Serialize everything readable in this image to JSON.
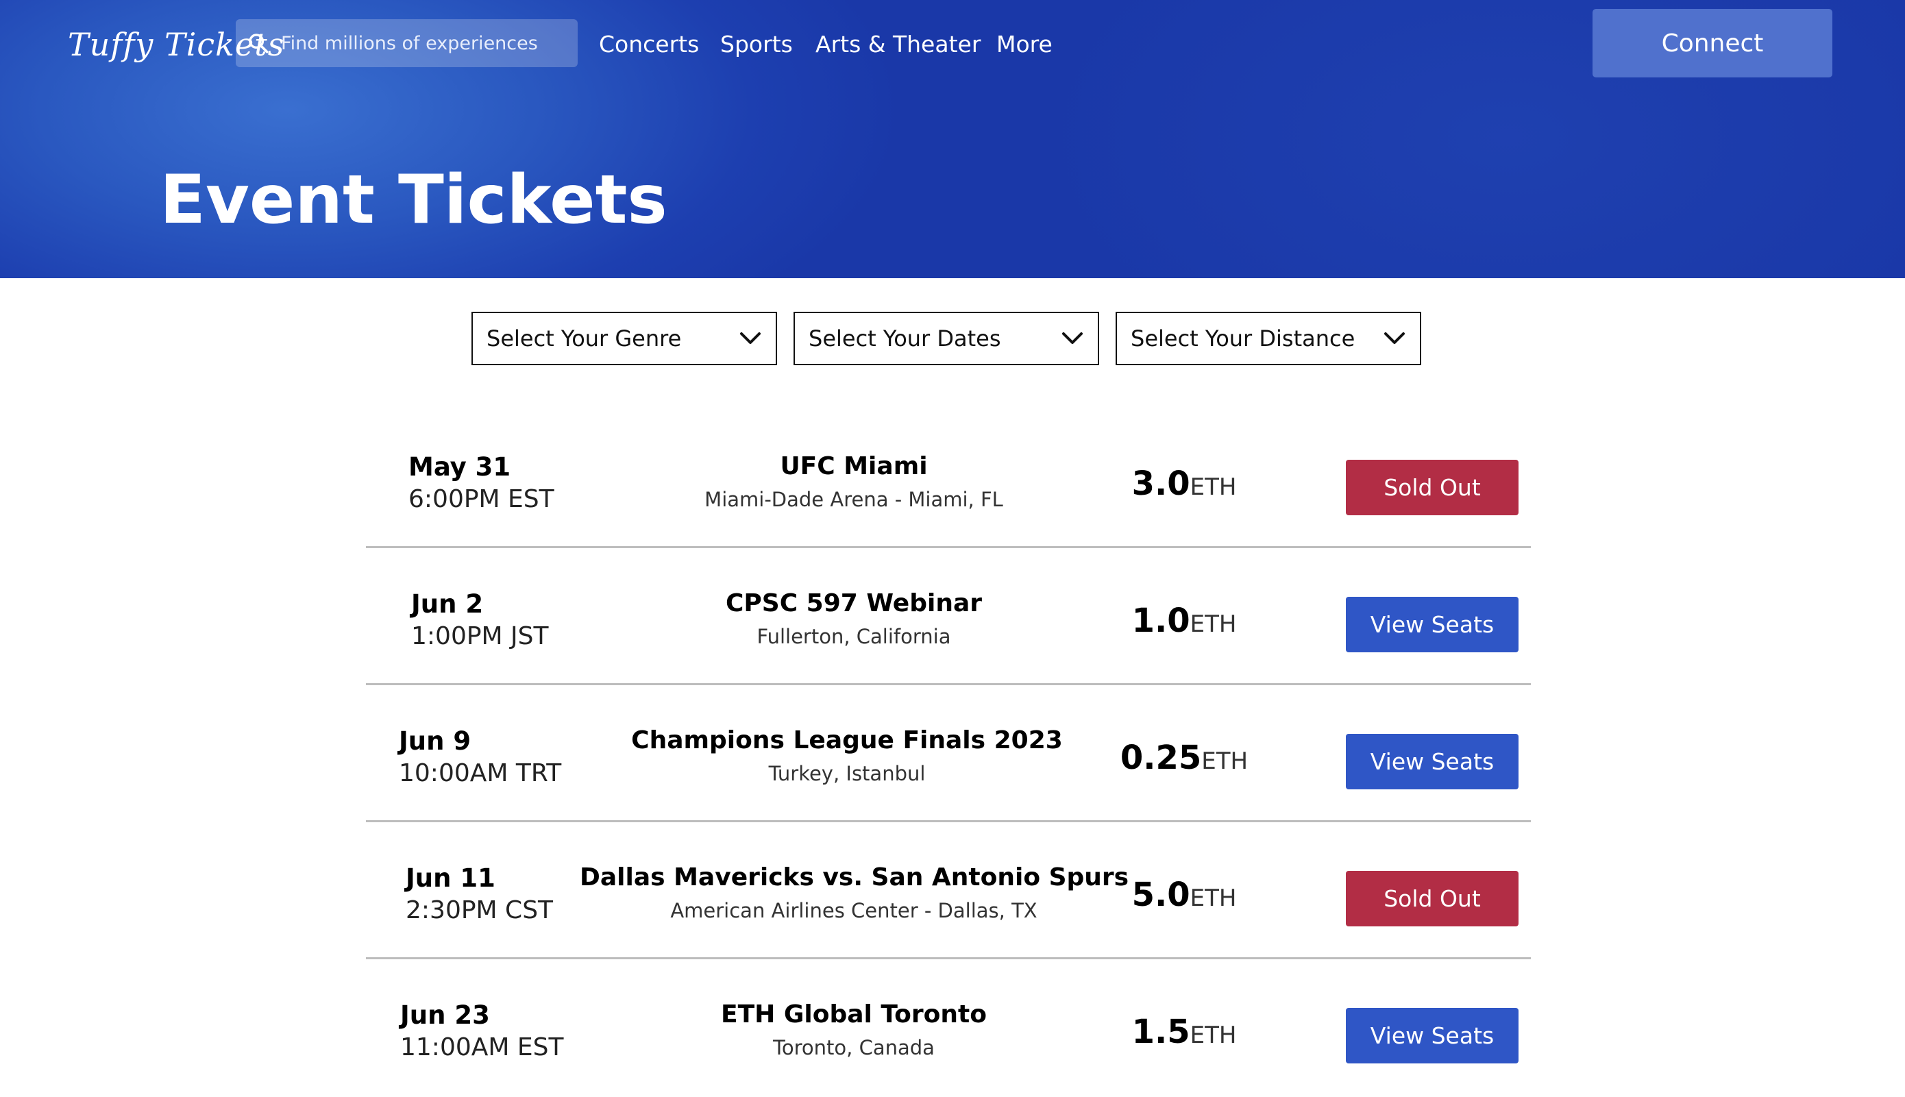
{
  "header": {
    "logo": "Tuffy Tickets",
    "search_placeholder": "Find millions of experiences",
    "nav": [
      "Concerts",
      "Sports",
      "Arts & Theater",
      "More"
    ],
    "connect_label": "Connect",
    "title": "Event Tickets"
  },
  "filters": [
    {
      "label": "Select Your Genre"
    },
    {
      "label": "Select Your Dates"
    },
    {
      "label": "Select Your Distance"
    }
  ],
  "events": [
    {
      "date": "May 31",
      "time": "6:00PM EST",
      "name": "UFC Miami",
      "venue": "Miami-Dade Arena - Miami, FL",
      "price": "3.0",
      "unit": "ETH",
      "action": "Sold Out",
      "status": "sold"
    },
    {
      "date": "Jun 2",
      "time": "1:00PM JST",
      "name": "CPSC 597 Webinar",
      "venue": "Fullerton, California",
      "price": "1.0",
      "unit": "ETH",
      "action": "View Seats",
      "status": "available"
    },
    {
      "date": "Jun 9",
      "time": "10:00AM TRT",
      "name": "Champions League Finals 2023",
      "venue": "Turkey, Istanbul",
      "price": "0.25",
      "unit": "ETH",
      "action": "View Seats",
      "status": "available"
    },
    {
      "date": "Jun 11",
      "time": "2:30PM CST",
      "name": "Dallas Mavericks vs. San Antonio Spurs",
      "venue": "American Airlines Center - Dallas, TX",
      "price": "5.0",
      "unit": "ETH",
      "action": "Sold Out",
      "status": "sold"
    },
    {
      "date": "Jun 23",
      "time": "11:00AM EST",
      "name": "ETH Global Toronto",
      "venue": "Toronto, Canada",
      "price": "1.5",
      "unit": "ETH",
      "action": "View Seats",
      "status": "available"
    }
  ],
  "colors": {
    "hero": "#1d3fb0",
    "sold_out": "#b22d45",
    "view_seats": "#2f56c6",
    "connect": "#5071cd"
  }
}
